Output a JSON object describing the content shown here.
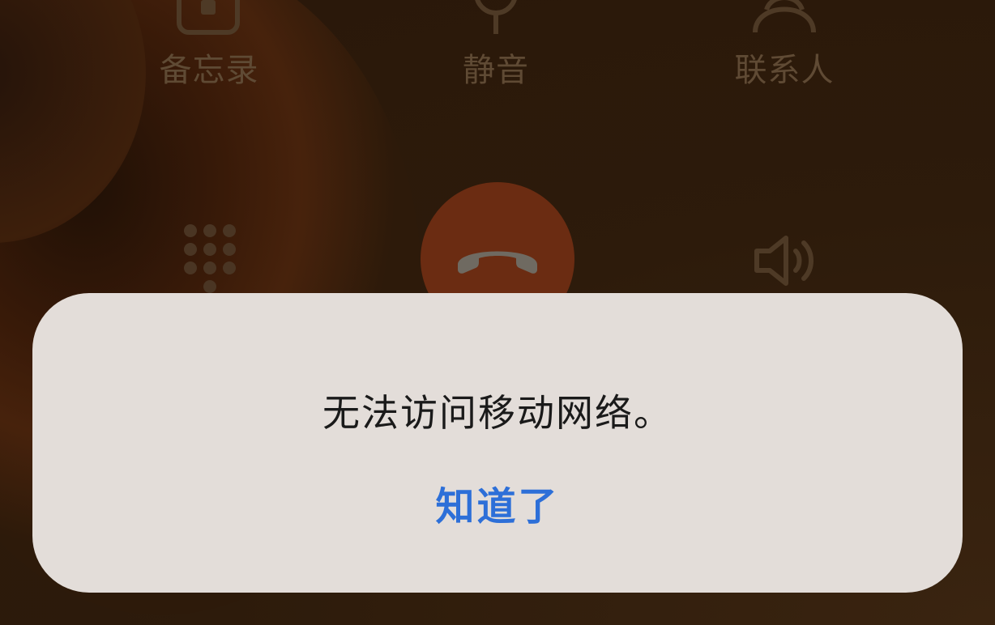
{
  "call_controls": {
    "memo_label": "备忘录",
    "mute_label": "静音",
    "contacts_label": "联系人",
    "memo_icon": "memo-icon",
    "mute_icon": "microphone-icon",
    "contacts_icon": "person-icon",
    "keypad_icon": "keypad-icon",
    "speaker_icon": "speaker-icon",
    "end_call_icon": "phone-hangup-icon"
  },
  "alert": {
    "message": "无法访问移动网络。",
    "button_label": "知道了"
  },
  "colors": {
    "background": "#2d1a0a",
    "end_call": "#6b2c12",
    "dialog": "#e3ddd9",
    "accent": "#2d6fd8"
  }
}
